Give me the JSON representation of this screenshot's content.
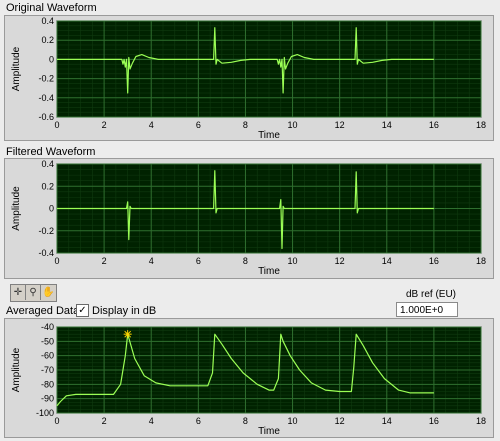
{
  "graphs": [
    {
      "key": "original",
      "title": "Original Waveform",
      "xlabel": "Time",
      "ylabel": "Amplitude",
      "xlim": [
        0,
        18
      ],
      "ylim": [
        -0.6,
        0.4
      ],
      "xticks": [
        "0",
        "2",
        "4",
        "6",
        "8",
        "10",
        "12",
        "14",
        "16",
        "18"
      ],
      "yticks": [
        "0.4",
        "0.2",
        "0",
        "-0.2",
        "-0.4",
        "-0.6"
      ]
    },
    {
      "key": "filtered",
      "title": "Filtered Waveform",
      "xlabel": "Time",
      "ylabel": "Amplitude",
      "xlim": [
        0,
        18
      ],
      "ylim": [
        -0.4,
        0.4
      ],
      "xticks": [
        "0",
        "2",
        "4",
        "6",
        "8",
        "10",
        "12",
        "14",
        "16",
        "18"
      ],
      "yticks": [
        "0.4",
        "0.2",
        "0",
        "-0.2",
        "-0.4"
      ]
    },
    {
      "key": "averaged",
      "title": "Averaged Data",
      "xlabel": "Time",
      "ylabel": "Amplitude",
      "xlim": [
        0,
        18
      ],
      "ylim": [
        -100,
        -40
      ],
      "xticks": [
        "0",
        "2",
        "4",
        "6",
        "8",
        "10",
        "12",
        "14",
        "16",
        "18"
      ],
      "yticks": [
        "-40",
        "-50",
        "-60",
        "-70",
        "-80",
        "-90",
        "-100"
      ]
    }
  ],
  "controls": {
    "display_in_db_label": "Display in dB",
    "display_in_db_checked": true,
    "check_mark": "✓",
    "db_ref_label": "dB ref (EU)",
    "db_ref_value": "1.000E+0"
  },
  "colors": {
    "plot_bg": "#002200",
    "trace": "#9bff55",
    "grid": "#2f6f2f",
    "cursor": "#ffd700"
  },
  "chart_data": [
    {
      "type": "line",
      "title": "Original Waveform",
      "xlabel": "Time",
      "ylabel": "Amplitude",
      "xlim": [
        0,
        18
      ],
      "ylim": [
        -0.6,
        0.4
      ],
      "series": [
        {
          "x": [
            0,
            2.75,
            2.8,
            2.85,
            2.9,
            2.95,
            3.0,
            3.05,
            3.1,
            3.2,
            3.35,
            3.6,
            3.9,
            4.3,
            6.65,
            6.7,
            6.75,
            6.8,
            7.0,
            7.4,
            7.8,
            8.2,
            9.35,
            9.4,
            9.45,
            9.5,
            9.55,
            9.6,
            9.65,
            9.7,
            9.8,
            9.95,
            10.2,
            10.5,
            10.9,
            12.65,
            12.7,
            12.75,
            12.8,
            13.0,
            13.4,
            13.8,
            14.2,
            16.0
          ],
          "y": [
            0,
            0,
            -0.05,
            0,
            -0.08,
            0,
            -0.35,
            0.02,
            -0.1,
            -0.04,
            0.03,
            0.05,
            0.02,
            0,
            0,
            0.33,
            -0.05,
            0,
            -0.04,
            -0.03,
            -0.01,
            0,
            0,
            -0.05,
            0,
            -0.08,
            0,
            -0.35,
            0.02,
            -0.1,
            -0.04,
            0.03,
            0.05,
            0.02,
            0,
            0,
            0.33,
            -0.05,
            0,
            -0.04,
            -0.03,
            -0.01,
            0,
            0
          ]
        }
      ]
    },
    {
      "type": "line",
      "title": "Filtered Waveform",
      "xlabel": "Time",
      "ylabel": "Amplitude",
      "xlim": [
        0,
        18
      ],
      "ylim": [
        -0.4,
        0.4
      ],
      "series": [
        {
          "x": [
            0,
            2.95,
            3.0,
            3.05,
            3.1,
            3.15,
            6.65,
            6.7,
            6.75,
            6.8,
            9.45,
            9.5,
            9.55,
            9.6,
            9.65,
            12.65,
            12.7,
            12.75,
            12.8,
            16.0
          ],
          "y": [
            0,
            0,
            0.06,
            -0.28,
            0.02,
            0,
            0,
            0.34,
            -0.04,
            0,
            0,
            0.08,
            -0.36,
            0.02,
            0,
            0,
            0.33,
            -0.04,
            0,
            0
          ]
        }
      ]
    },
    {
      "type": "line",
      "title": "Averaged Data",
      "xlabel": "Time",
      "ylabel": "Amplitude",
      "xlim": [
        0,
        18
      ],
      "ylim": [
        -100,
        -40
      ],
      "series": [
        {
          "x": [
            0,
            0.15,
            0.4,
            0.8,
            2.4,
            2.7,
            2.9,
            3.0,
            3.3,
            3.7,
            4.2,
            4.8,
            5.5,
            6.4,
            6.6,
            6.7,
            7.0,
            7.4,
            7.9,
            8.5,
            9.0,
            9.2,
            9.4,
            9.5,
            9.6,
            9.9,
            10.3,
            10.8,
            11.4,
            12.0,
            12.5,
            12.6,
            12.7,
            13.0,
            13.4,
            13.9,
            14.5,
            15.0,
            16.0
          ],
          "y": [
            -95,
            -92,
            -88,
            -87,
            -87,
            -80,
            -60,
            -45,
            -62,
            -74,
            -79,
            -81,
            -81,
            -81,
            -72,
            -45,
            -52,
            -62,
            -72,
            -80,
            -84,
            -84,
            -76,
            -45,
            -50,
            -60,
            -70,
            -79,
            -84,
            -85,
            -85,
            -68,
            -45,
            -53,
            -65,
            -76,
            -84,
            -86,
            -86
          ]
        }
      ],
      "marker": {
        "x": 3.0,
        "y": -45
      }
    }
  ]
}
